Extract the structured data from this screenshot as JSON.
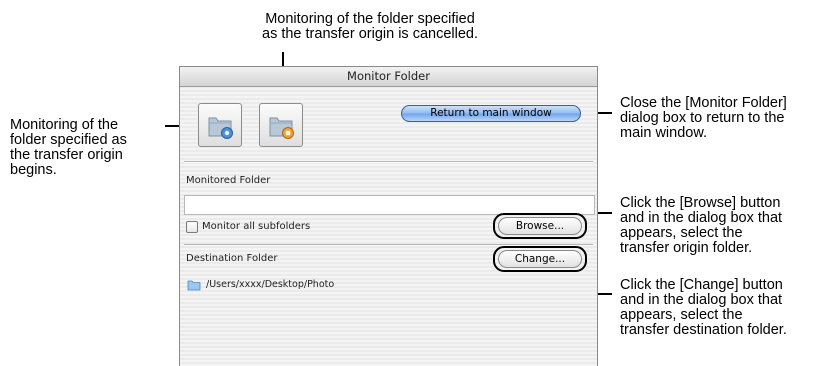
{
  "callouts": {
    "top": [
      "Monitoring of the folder specified",
      "as the transfer origin is cancelled."
    ],
    "left": [
      "Monitoring of the",
      "folder specified as",
      "the transfer origin",
      "begins."
    ],
    "return": [
      "Close the [Monitor Folder]",
      "dialog box to return to the",
      "main window."
    ],
    "browse": [
      "Click the [Browse] button",
      "and in the dialog box that",
      "appears, select the",
      "transfer origin folder."
    ],
    "change": [
      "Click the [Change] button",
      "and in the dialog box that",
      "appears, select the",
      "transfer destination folder."
    ]
  },
  "window": {
    "title": "Monitor Folder",
    "return_button": "Return to main window",
    "monitored_folder_label": "Monitored Folder",
    "monitored_folder_value": "",
    "subfolders_checkbox_label": "Monitor all subfolders",
    "browse_button": "Browse...",
    "destination_label": "Destination Folder",
    "change_button": "Change...",
    "destination_path": "/Users/xxxx/Desktop/Photo"
  },
  "icons": {
    "start_monitoring": "folder-start-icon",
    "stop_monitoring": "folder-stop-icon",
    "destination_folder": "folder-icon"
  }
}
